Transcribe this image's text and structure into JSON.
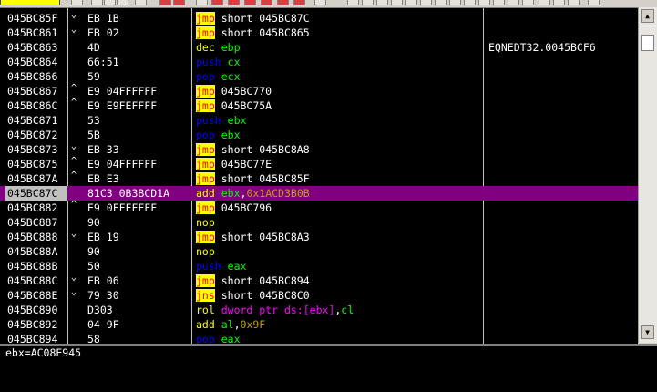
{
  "rows": [
    {
      "addr": "045BC85F",
      "mark": "⌄",
      "hex": "EB 1B",
      "mnemonic": "jmp",
      "mn_style": "jmp",
      "ops": [
        {
          "t": "short 045BC87C",
          "s": "white"
        }
      ],
      "comment": ""
    },
    {
      "addr": "045BC861",
      "mark": "⌄",
      "hex": "EB 02",
      "mnemonic": "jmp",
      "mn_style": "jmp",
      "ops": [
        {
          "t": "short 045BC865",
          "s": "white"
        }
      ],
      "comment": ""
    },
    {
      "addr": "045BC863",
      "mark": "",
      "hex": "4D",
      "mnemonic": "dec",
      "mn_style": "yellow",
      "ops": [
        {
          "t": "ebp",
          "s": "green"
        }
      ],
      "comment": "EQNEDT32.0045BCF6"
    },
    {
      "addr": "045BC864",
      "mark": "",
      "hex": "66:51",
      "mnemonic": "push",
      "mn_style": "blue",
      "ops": [
        {
          "t": "cx",
          "s": "green"
        }
      ],
      "comment": ""
    },
    {
      "addr": "045BC866",
      "mark": "",
      "hex": "59",
      "mnemonic": "pop",
      "mn_style": "blue",
      "ops": [
        {
          "t": "ecx",
          "s": "green"
        }
      ],
      "comment": ""
    },
    {
      "addr": "045BC867",
      "mark": "^",
      "hex": "E9 04FFFFFF",
      "mnemonic": "jmp",
      "mn_style": "jmp",
      "ops": [
        {
          "t": "045BC770",
          "s": "white"
        }
      ],
      "comment": ""
    },
    {
      "addr": "045BC86C",
      "mark": "^",
      "hex": "E9 E9FEFFFF",
      "mnemonic": "jmp",
      "mn_style": "jmp",
      "ops": [
        {
          "t": "045BC75A",
          "s": "white"
        }
      ],
      "comment": ""
    },
    {
      "addr": "045BC871",
      "mark": "",
      "hex": "53",
      "mnemonic": "push",
      "mn_style": "blue",
      "ops": [
        {
          "t": "ebx",
          "s": "green"
        }
      ],
      "comment": ""
    },
    {
      "addr": "045BC872",
      "mark": "",
      "hex": "5B",
      "mnemonic": "pop",
      "mn_style": "blue",
      "ops": [
        {
          "t": "ebx",
          "s": "green"
        }
      ],
      "comment": ""
    },
    {
      "addr": "045BC873",
      "mark": "⌄",
      "hex": "EB 33",
      "mnemonic": "jmp",
      "mn_style": "jmp",
      "ops": [
        {
          "t": "short 045BC8A8",
          "s": "white"
        }
      ],
      "comment": ""
    },
    {
      "addr": "045BC875",
      "mark": "^",
      "hex": "E9 04FFFFFF",
      "mnemonic": "jmp",
      "mn_style": "jmp",
      "ops": [
        {
          "t": "045BC77E",
          "s": "white"
        }
      ],
      "comment": ""
    },
    {
      "addr": "045BC87A",
      "mark": "^",
      "hex": "EB E3",
      "mnemonic": "jmp",
      "mn_style": "jmp",
      "ops": [
        {
          "t": "short 045BC85F",
          "s": "white"
        }
      ],
      "comment": ""
    },
    {
      "addr": "045BC87C",
      "mark": "",
      "hex": "81C3 0B3BCD1A",
      "mnemonic": "add",
      "mn_style": "yellow",
      "ops": [
        {
          "t": "ebx",
          "s": "green"
        },
        {
          "t": ",",
          "s": "white"
        },
        {
          "t": "0x1ACD3B0B",
          "s": "olive"
        }
      ],
      "comment": "",
      "selected": true
    },
    {
      "addr": "045BC882",
      "mark": "^",
      "hex": "E9 0FFFFFFF",
      "mnemonic": "jmp",
      "mn_style": "jmp",
      "ops": [
        {
          "t": "045BC796",
          "s": "white"
        }
      ],
      "comment": ""
    },
    {
      "addr": "045BC887",
      "mark": "",
      "hex": "90",
      "mnemonic": "nop",
      "mn_style": "yellow",
      "ops": [],
      "comment": ""
    },
    {
      "addr": "045BC888",
      "mark": "⌄",
      "hex": "EB 19",
      "mnemonic": "jmp",
      "mn_style": "jmp",
      "ops": [
        {
          "t": "short 045BC8A3",
          "s": "white"
        }
      ],
      "comment": ""
    },
    {
      "addr": "045BC88A",
      "mark": "",
      "hex": "90",
      "mnemonic": "nop",
      "mn_style": "yellow",
      "ops": [],
      "comment": ""
    },
    {
      "addr": "045BC88B",
      "mark": "",
      "hex": "50",
      "mnemonic": "push",
      "mn_style": "blue",
      "ops": [
        {
          "t": "eax",
          "s": "green"
        }
      ],
      "comment": ""
    },
    {
      "addr": "045BC88C",
      "mark": "⌄",
      "hex": "EB 06",
      "mnemonic": "jmp",
      "mn_style": "jmp",
      "ops": [
        {
          "t": "short 045BC894",
          "s": "white"
        }
      ],
      "comment": ""
    },
    {
      "addr": "045BC88E",
      "mark": "⌄",
      "hex": "79 30",
      "mnemonic": "jns",
      "mn_style": "jmp",
      "ops": [
        {
          "t": "short 045BC8C0",
          "s": "white"
        }
      ],
      "comment": ""
    },
    {
      "addr": "045BC890",
      "mark": "",
      "hex": "D303",
      "mnemonic": "rol",
      "mn_style": "yellow",
      "ops": [
        {
          "t": "dword ptr ds:[ebx]",
          "s": "magenta"
        },
        {
          "t": ",",
          "s": "white"
        },
        {
          "t": "cl",
          "s": "green"
        }
      ],
      "comment": ""
    },
    {
      "addr": "045BC892",
      "mark": "",
      "hex": "04 9F",
      "mnemonic": "add",
      "mn_style": "yellow",
      "ops": [
        {
          "t": "al",
          "s": "green"
        },
        {
          "t": ",",
          "s": "white"
        },
        {
          "t": "0x9F",
          "s": "olive"
        }
      ],
      "comment": ""
    },
    {
      "addr": "045BC894",
      "mark": "",
      "hex": "58",
      "mnemonic": "pop",
      "mn_style": "blue",
      "ops": [
        {
          "t": "eax",
          "s": "green"
        }
      ],
      "comment": ""
    }
  ],
  "info": {
    "text": "ebx=AC08E945"
  },
  "colors": {
    "background": "#000000",
    "selection": "#800080",
    "jump_highlight": "#ffff00",
    "jump_text": "#ff0000",
    "register": "#00ff00",
    "constant": "#c0a000",
    "stack_op": "#0000ff",
    "memory_op": "#ff00ff"
  }
}
